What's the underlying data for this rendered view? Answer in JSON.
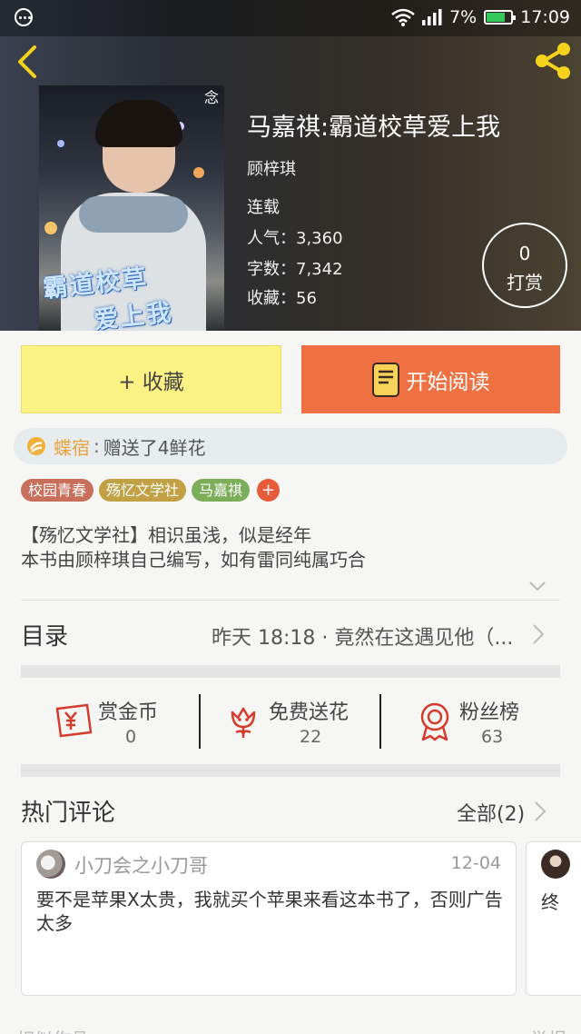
{
  "status_bar": {
    "battery": "7%",
    "time": "17:09"
  },
  "book": {
    "title": "马嘉祺:霸道校草爱上我",
    "author": "顾梓琪",
    "status": "连载",
    "popularity": "人气：3,360",
    "word_count": "字数：7,342",
    "favorites": "收藏：56",
    "cover_caption_1": "霸道校草",
    "cover_caption_2": "爱上我",
    "cover_mark": "念"
  },
  "reward": {
    "count": "0",
    "label": "打赏"
  },
  "actions": {
    "collect_label": "+ 收藏",
    "read_label": "开始阅读"
  },
  "gift": {
    "user": "蝶宿",
    "separator": ":",
    "text": "赠送了4鲜花"
  },
  "tags": [
    {
      "label": "校园青春",
      "color": "#c86f5b"
    },
    {
      "label": "殇忆文学社",
      "color": "#c2a145"
    },
    {
      "label": "马嘉祺",
      "color": "#7cae5a"
    }
  ],
  "tag_add": "+",
  "intro": {
    "line1": "【殇忆文学社】相识虽浅，似是经年",
    "line2": "本书由顾梓琪自己编写，如有雷同纯属巧合"
  },
  "catalog": {
    "title": "目录",
    "latest": "昨天 18:18 · 竟然在这遇见他（..."
  },
  "stats": {
    "coins": {
      "label": "赏金币",
      "value": "0"
    },
    "flowers": {
      "label": "免费送花",
      "value": "22"
    },
    "fans": {
      "label": "粉丝榜",
      "value": "63"
    }
  },
  "comments": {
    "title": "热门评论",
    "all_label": "全部(2)",
    "items": [
      {
        "user": "小刀会之小刀哥",
        "date": "12-04",
        "text": "要不是苹果X太贵，我就买个苹果来看这本书了，否则广告太多"
      },
      {
        "text": "终"
      }
    ]
  },
  "footer": {
    "left": "相似作品",
    "right": "举报"
  },
  "colors": {
    "accent_orange": "#ef7040",
    "collect_yellow": "#fbf283",
    "icon_red": "#d63a2a"
  }
}
